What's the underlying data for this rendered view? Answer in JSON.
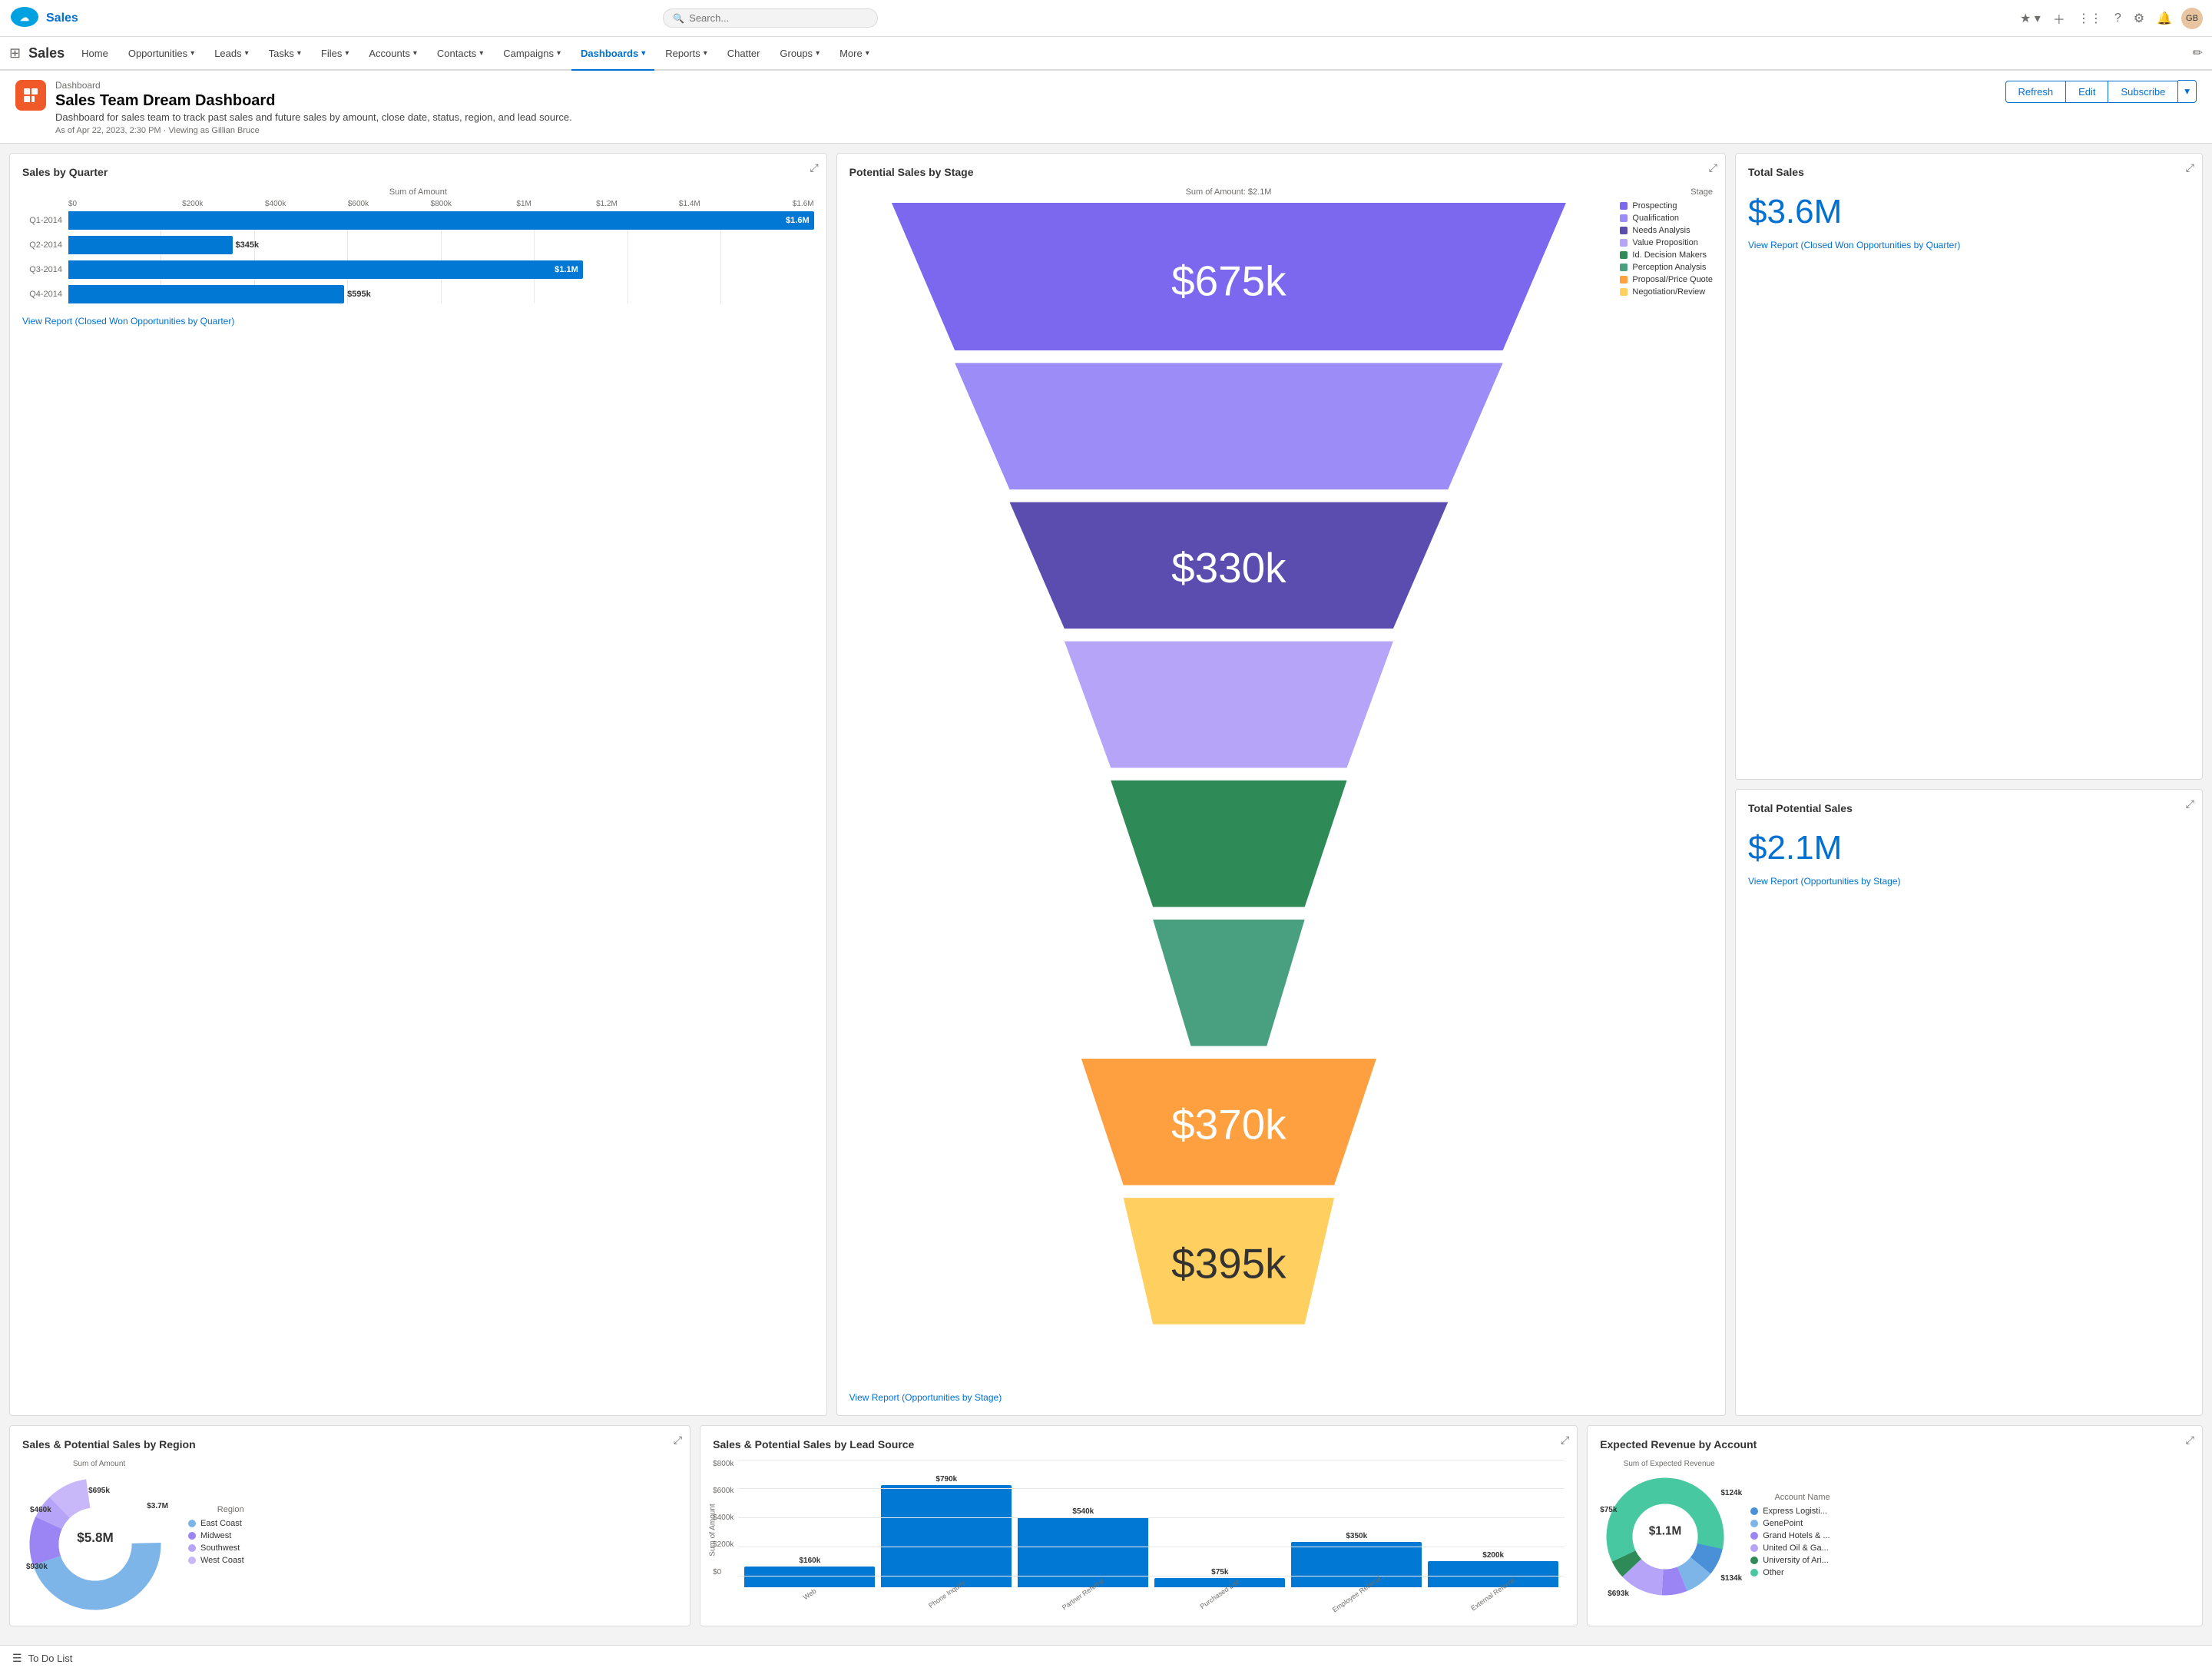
{
  "brand": {
    "name": "Salesforce",
    "app_name": "Sales"
  },
  "top_nav": {
    "search_placeholder": "Search...",
    "icons": [
      "star",
      "add",
      "waffle",
      "help",
      "settings",
      "notification",
      "avatar"
    ]
  },
  "app_nav": {
    "items": [
      {
        "label": "Home",
        "has_dropdown": false,
        "active": false
      },
      {
        "label": "Opportunities",
        "has_dropdown": true,
        "active": false
      },
      {
        "label": "Leads",
        "has_dropdown": true,
        "active": false
      },
      {
        "label": "Tasks",
        "has_dropdown": true,
        "active": false
      },
      {
        "label": "Files",
        "has_dropdown": true,
        "active": false
      },
      {
        "label": "Accounts",
        "has_dropdown": true,
        "active": false
      },
      {
        "label": "Contacts",
        "has_dropdown": true,
        "active": false
      },
      {
        "label": "Campaigns",
        "has_dropdown": true,
        "active": false
      },
      {
        "label": "Dashboards",
        "has_dropdown": true,
        "active": true
      },
      {
        "label": "Reports",
        "has_dropdown": true,
        "active": false
      },
      {
        "label": "Chatter",
        "has_dropdown": false,
        "active": false
      },
      {
        "label": "Groups",
        "has_dropdown": true,
        "active": false
      },
      {
        "label": "More",
        "has_dropdown": true,
        "active": false
      }
    ]
  },
  "dashboard": {
    "breadcrumb": "Dashboard",
    "title": "Sales Team Dream Dashboard",
    "description": "Dashboard for sales team to track past sales and future sales by amount, close date, status, region, and lead source.",
    "meta": "As of Apr 22, 2023, 2:30 PM · Viewing as Gillian Bruce",
    "buttons": {
      "refresh": "Refresh",
      "edit": "Edit",
      "subscribe": "Subscribe"
    }
  },
  "widget_quarter": {
    "title": "Sales by Quarter",
    "axis_label": "Sum of Amount",
    "x_ticks": [
      "$0",
      "$200k",
      "$400k",
      "$600k",
      "$800k",
      "$1M",
      "$1.2M",
      "$1.4M",
      "$1.6M"
    ],
    "bars": [
      {
        "label": "Q1-2014",
        "value": "$1.6M",
        "pct": 100
      },
      {
        "label": "Q2-2014",
        "value": "$345k",
        "pct": 22
      },
      {
        "label": "Q3-2014",
        "value": "$1.1M",
        "pct": 69
      },
      {
        "label": "Q4-2014",
        "value": "$595k",
        "pct": 37
      }
    ],
    "link": "View Report (Closed Won Opportunities by Quarter)"
  },
  "widget_stage": {
    "title": "Potential Sales by Stage",
    "subtitle": "Sum of Amount: $2.1M",
    "legend_label": "Stage",
    "stages": [
      {
        "label": "Prospecting",
        "value": "$675k",
        "color": "#7B68EE",
        "width_pct": 100
      },
      {
        "label": "Qualification",
        "value": null,
        "color": "#9B85F5",
        "width_pct": 80
      },
      {
        "label": "Needs Analysis",
        "value": "$330k",
        "color": "#6A5ACD",
        "width_pct": 65
      },
      {
        "label": "Value Proposition",
        "value": null,
        "color": "#B5A4F7",
        "width_pct": 55
      },
      {
        "label": "Id. Decision Makers",
        "value": null,
        "color": "#2E8B57",
        "width_pct": 45
      },
      {
        "label": "Perception Analysis",
        "value": null,
        "color": "#3CB371",
        "width_pct": 38
      },
      {
        "label": "Proposal/Price Quote",
        "value": "$370k",
        "color": "#FFA500",
        "width_pct": 32
      },
      {
        "label": "Negotiation/Review",
        "value": "$395k",
        "color": "#FFD700",
        "width_pct": 28
      }
    ],
    "link": "View Report (Opportunities by Stage)"
  },
  "widget_total_sales": {
    "title": "Total Sales",
    "value": "$3.6M",
    "link": "View Report (Closed Won Opportunities by Quarter)"
  },
  "widget_total_potential": {
    "title": "Total Potential Sales",
    "value": "$2.1M",
    "link": "View Report (Opportunities by Stage)"
  },
  "widget_region": {
    "title": "Sales & Potential Sales by Region",
    "axis_label": "Sum of Amount",
    "total": "$5.8M",
    "legend_label": "Region",
    "segments": [
      {
        "label": "East Coast",
        "value": "$3.7M",
        "color": "#7EB5E8",
        "pct": 45
      },
      {
        "label": "Midwest",
        "value": "$930k",
        "color": "#9B85F5",
        "pct": 12
      },
      {
        "label": "Southwest",
        "value": "$460k",
        "color": "#B5A4F7",
        "pct": 6
      },
      {
        "label": "West Coast",
        "value": "$695k",
        "color": "#C5B9F9",
        "pct": 10
      }
    ]
  },
  "widget_lead_source": {
    "title": "Sales & Potential Sales by Lead Source",
    "y_label": "Sum of Amount",
    "y_ticks": [
      "$800k",
      "$600k",
      "$400k",
      "$200k",
      "$0"
    ],
    "bars": [
      {
        "label": "Web",
        "value": "$160k",
        "height_pct": 20
      },
      {
        "label": "Phone Inquiry",
        "value": "$790k",
        "height_pct": 99
      },
      {
        "label": "Partner Referral",
        "value": "$540k",
        "height_pct": 68
      },
      {
        "label": "Purchased List",
        "value": "$75k",
        "height_pct": 9
      },
      {
        "label": "Employee Referral",
        "value": "$350k",
        "height_pct": 44
      },
      {
        "label": "External Referral",
        "value": "$200k",
        "height_pct": 25
      }
    ]
  },
  "widget_expected": {
    "title": "Expected Revenue by Account",
    "axis_label": "Sum of Expected Revenue",
    "total": "$1.1M",
    "legend_label": "Account Name",
    "segments": [
      {
        "label": "Express Logisti...",
        "value": "$124k",
        "color": "#4A90D9",
        "pct": 11
      },
      {
        "label": "GenePoint",
        "value": null,
        "color": "#7EB5E8",
        "pct": 8
      },
      {
        "label": "Grand Hotels &...",
        "value": "$75k",
        "color": "#9B85F5",
        "pct": 7
      },
      {
        "label": "United Oil & Ga...",
        "value": "$134k",
        "color": "#B5A4F7",
        "pct": 12
      },
      {
        "label": "University of Ari...",
        "value": null,
        "color": "#2E8B57",
        "pct": 5
      },
      {
        "label": "Other",
        "value": "$693k",
        "color": "#48C8A0",
        "pct": 60
      }
    ]
  },
  "footer": {
    "label": "To Do List"
  }
}
